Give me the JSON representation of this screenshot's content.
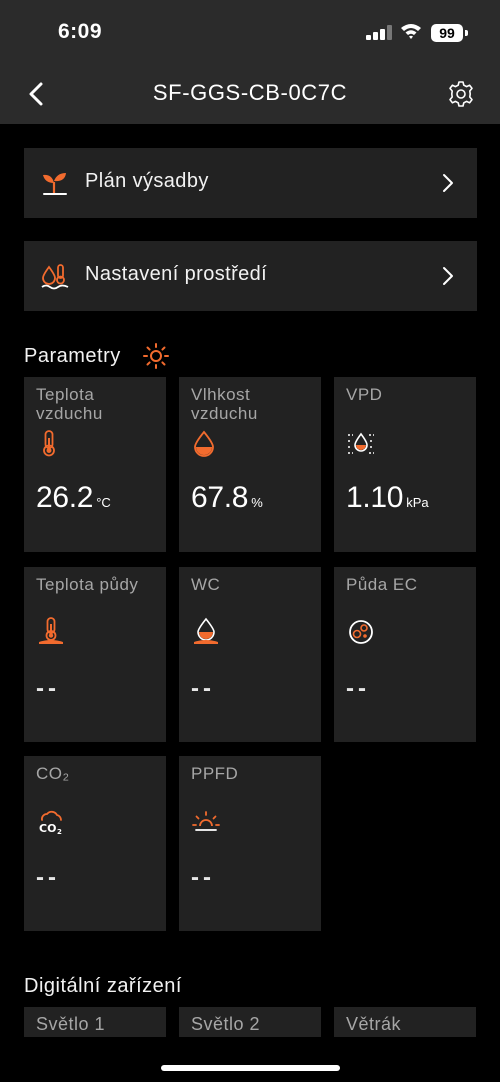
{
  "status_bar": {
    "time": "6:09",
    "battery": "99"
  },
  "nav": {
    "title": "SF-GGS-CB-0C7C"
  },
  "menu": [
    {
      "label": "Plán výsadby",
      "icon": "seedling-icon"
    },
    {
      "label": "Nastavení prostředí",
      "icon": "water-temperature-icon"
    }
  ],
  "parameters": {
    "title": "Parametry",
    "cards": [
      {
        "label": "Teplota vzduchu",
        "value": "26.2",
        "unit": "°C",
        "icon": "thermometer-icon"
      },
      {
        "label": "Vlhkost vzduchu",
        "value": "67.8",
        "unit": "%",
        "icon": "droplet-icon"
      },
      {
        "label": "VPD",
        "value": "1.10",
        "unit": "kPa",
        "icon": "vpd-icon"
      },
      {
        "label": "Teplota půdy",
        "value": "--",
        "unit": "",
        "icon": "soil-thermometer-icon"
      },
      {
        "label": "WC",
        "value": "--",
        "unit": "",
        "icon": "soil-water-icon"
      },
      {
        "label": "Půda EC",
        "value": "--",
        "unit": "",
        "icon": "soil-ec-icon"
      },
      {
        "label": "CO₂",
        "value": "--",
        "unit": "",
        "icon": "co2-cloud-icon"
      },
      {
        "label": "PPFD",
        "value": "--",
        "unit": "",
        "icon": "sunrise-icon"
      }
    ]
  },
  "devices": {
    "title": "Digitální zařízení",
    "items": [
      {
        "label": "Světlo 1"
      },
      {
        "label": "Světlo 2"
      },
      {
        "label": "Větrák"
      }
    ]
  },
  "colors": {
    "accent": "#f26b2e",
    "card": "#222222",
    "bar": "#2b2b2b"
  }
}
